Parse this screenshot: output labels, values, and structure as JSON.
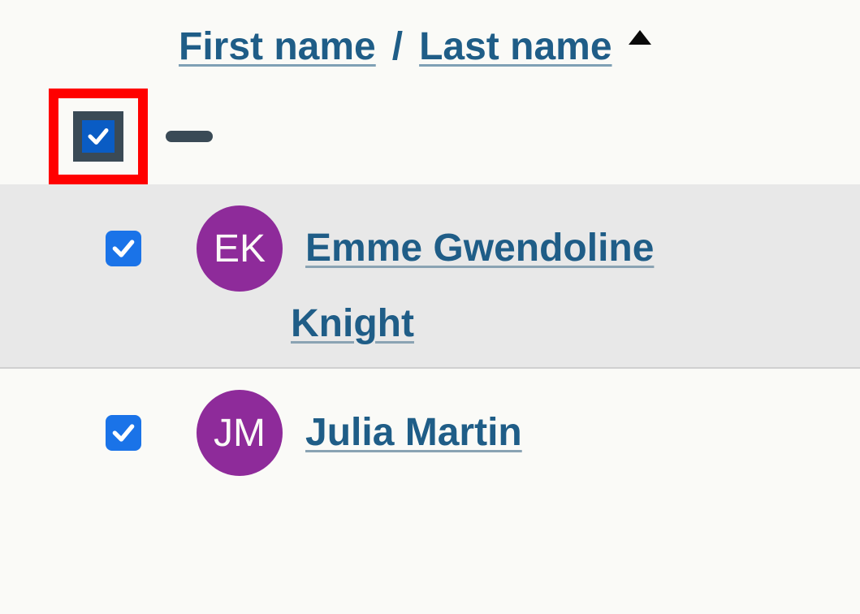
{
  "header": {
    "first_name_label": "First name",
    "separator": "/",
    "last_name_label": "Last name",
    "sort_direction": "asc"
  },
  "select_all": {
    "checked": true
  },
  "users": [
    {
      "checked": true,
      "initials": "EK",
      "name_line1": "Emme Gwendoline",
      "name_line2": "Knight",
      "highlighted": true
    },
    {
      "checked": true,
      "initials": "JM",
      "name_line1": "Julia Martin",
      "name_line2": "",
      "highlighted": false
    }
  ],
  "colors": {
    "avatar_bg": "#8e2b9a",
    "checkbox_bg": "#1a73e8",
    "link": "#1f5d87",
    "highlight_border": "#ff0000"
  }
}
